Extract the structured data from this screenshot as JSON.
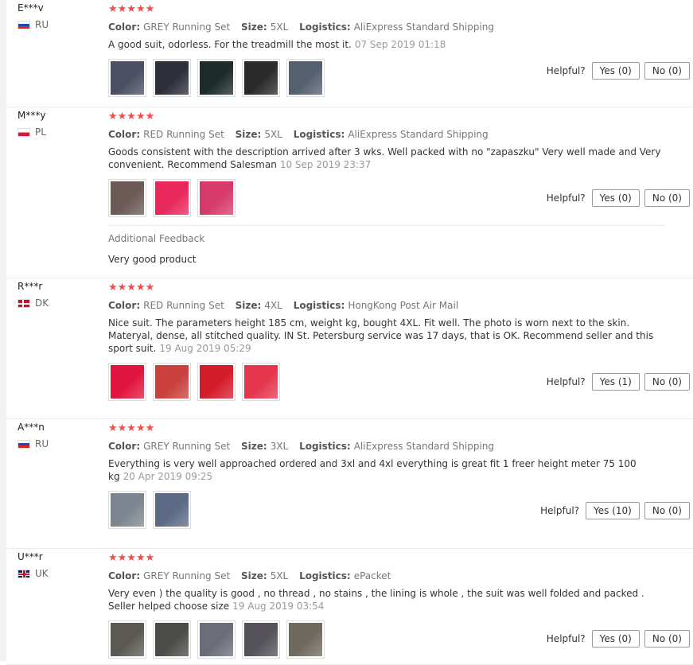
{
  "helpful_label": "Helpful?",
  "labels": {
    "color": "Color:",
    "size": "Size:",
    "logistics": "Logistics:"
  },
  "stars": "★★★★★",
  "reviews": [
    {
      "user": "E***v",
      "country": "RU",
      "color": "GREY Running Set",
      "size": "5XL",
      "logistics": "AliExpress Standard Shipping",
      "text": "A good suit, odorless. For the treadmill the most it.",
      "date": "07 Sep 2019 01:18",
      "yes": "Yes (0)",
      "no": "No (0)",
      "photo_colors": [
        "#4a4f63",
        "#2c2f3a",
        "#1d2b2a",
        "#2a2a2a",
        "#55606e"
      ]
    },
    {
      "user": "M***y",
      "country": "PL",
      "color": "RED Running Set",
      "size": "5XL",
      "logistics": "AliExpress Standard Shipping",
      "text": "Goods consistent with the description arrived after 3 wks. Well packed with no \"zapaszku\" Very well made and Very convenient. Recommend Salesman",
      "date": "10 Sep 2019 23:37",
      "yes": "Yes (0)",
      "no": "No (0)",
      "photo_colors": [
        "#6b5a55",
        "#e8275b",
        "#d63a6a"
      ],
      "additional_title": "Additional Feedback",
      "additional_text": "Very good product"
    },
    {
      "user": "R***r",
      "country": "DK",
      "color": "RED Running Set",
      "size": "4XL",
      "logistics": "HongKong Post Air Mail",
      "text": "Nice suit. The parameters height 185 cm, weight kg, bought 4XL. Fit well. The photo is worn next to the skin. Materyal, dense, all stitched quality. IN St. Petersburg service was 17 days, that is OK. Recommend seller and this sport suit.",
      "date": "19 Aug 2019 05:29",
      "yes": "Yes (1)",
      "no": "No (0)",
      "photo_colors": [
        "#e0153d",
        "#c9403c",
        "#d41d2a",
        "#e5364e"
      ]
    },
    {
      "user": "A***n",
      "country": "RU",
      "color": "GREY Running Set",
      "size": "3XL",
      "logistics": "AliExpress Standard Shipping",
      "text": "Everything is very well approached ordered and 3xl and 4xl everything is great fit 1 freer height meter 75 100 kg",
      "date": "20 Apr 2019 09:25",
      "yes": "Yes (10)",
      "no": "No (0)",
      "photo_colors": [
        "#7d8690",
        "#5c6a85"
      ]
    },
    {
      "user": "U***r",
      "country": "UK",
      "color": "GREY Running Set",
      "size": "5XL",
      "logistics": "ePacket",
      "text": "Very even ) the quality is good , no thread , no stains , the lining is whole , the suit was well folded and packed . Seller helped choose size",
      "date": "19 Aug 2019 03:54",
      "yes": "Yes (0)",
      "no": "No (0)",
      "photo_colors": [
        "#5a5a52",
        "#4b4b48",
        "#6b6e78",
        "#55525a",
        "#6f6a5e"
      ]
    }
  ]
}
